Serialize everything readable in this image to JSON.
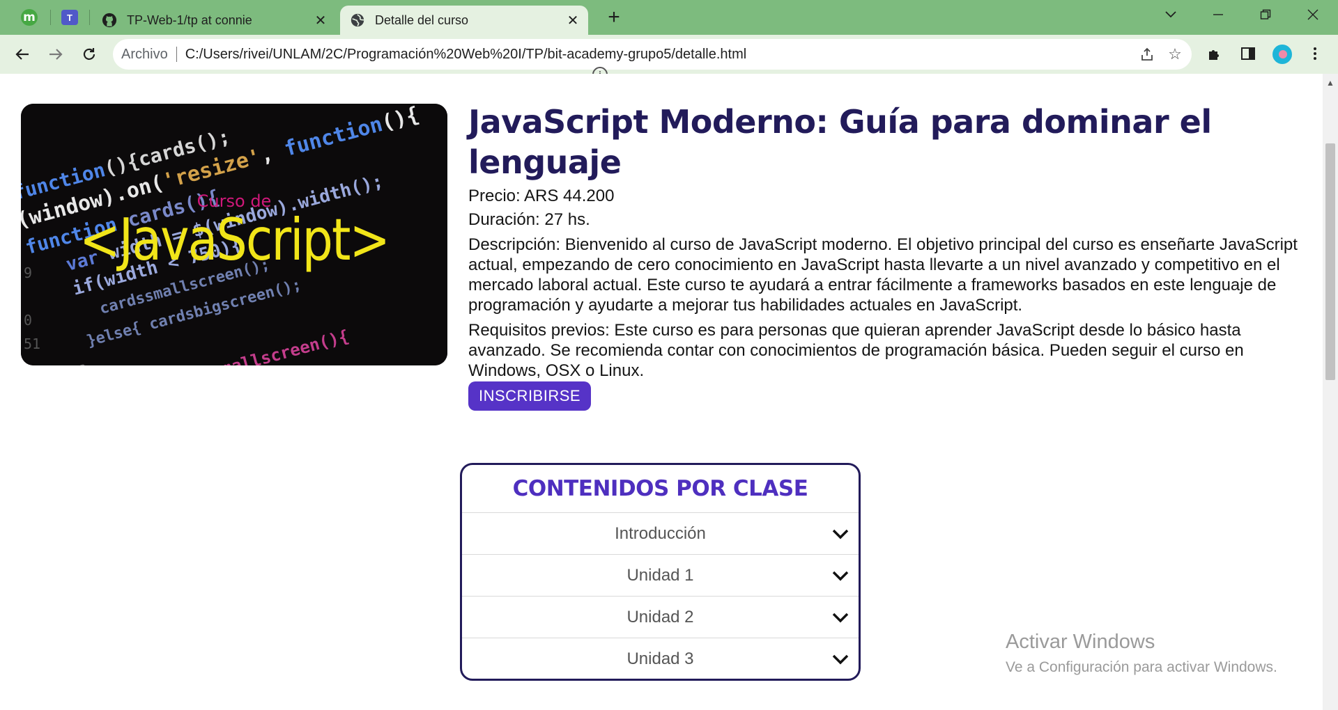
{
  "browser": {
    "tabs": [
      {
        "title": "TP-Web-1/tp at connie",
        "icon": "github-icon"
      },
      {
        "title": "Detalle del curso",
        "icon": "globe-icon",
        "active": true
      }
    ],
    "pinned_tabs": [
      {
        "icon": "m-app-icon",
        "glyph": "m"
      },
      {
        "icon": "teams-icon",
        "glyph": "T"
      }
    ],
    "address_bar": {
      "origin_label": "Archivo",
      "url": "C:/Users/rivei/UNLAM/2C/Programación%20Web%20I/TP/bit-academy-grupo5/detalle.html"
    }
  },
  "course": {
    "title": "JavaScript Moderno: Guía para dominar el lenguaje",
    "price": "Precio: ARS 44.200",
    "duration": "Duración: 27 hs.",
    "description": "Descripción: Bienvenido al curso de JavaScript moderno. El objetivo principal del curso es enseñarte JavaScript actual, empezando de cero conocimiento en JavaScript hasta llevarte a un nivel avanzado y competitivo en el mercado laboral actual. Este curso te ayudará a entrar fácilmente a frameworks basados en este lenguaje de programación y ayudarte a mejorar tus habilidades actuales en JavaScript.",
    "requirements": "Requisitos previos: Este curso es para personas que quieran aprender JavaScript desde lo básico hasta avanzado. Se recomienda contar con conocimientos de programación básica. Pueden seguir el curso en Windows, OSX o Linux.",
    "enroll_label": "INSCRIBIRSE",
    "image": {
      "caption_small": "Curso de",
      "caption_big": "<JavaScript>"
    }
  },
  "contents": {
    "title": "CONTENIDOS POR CLASE",
    "units": [
      "Introducción",
      "Unidad 1",
      "Unidad 2",
      "Unidad 3"
    ]
  },
  "watermark": {
    "line1": "Activar Windows",
    "line2": "Ve a Configuración para activar Windows."
  },
  "colors": {
    "title": "#221b5a",
    "accent": "#5633c7",
    "tabbar": "#7dbb7e"
  }
}
